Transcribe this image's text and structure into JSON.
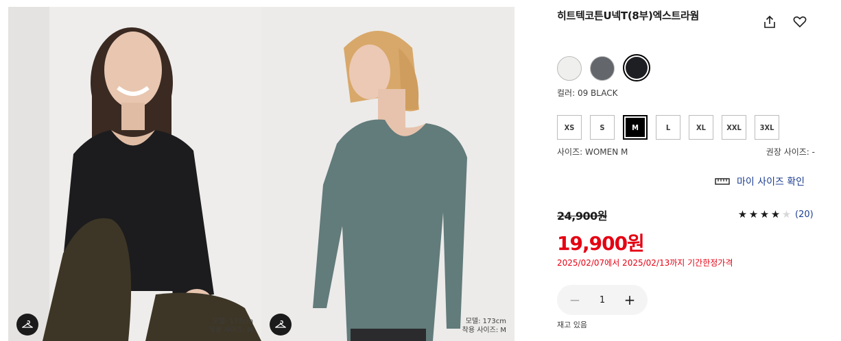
{
  "gallery": {
    "photos": [
      {
        "model_height": "모델: 173cm",
        "wear_size": "착용 사이즈: M",
        "icon": "hanger-icon"
      },
      {
        "model_height": "모델: 173cm",
        "wear_size": "착용 사이즈: M",
        "icon": "hanger-icon"
      }
    ]
  },
  "product": {
    "title": "히트텍코튼U넥T(8부)엑스트라웜",
    "share_icon": "share-icon",
    "favorite_icon": "heart-icon"
  },
  "colors": {
    "options": [
      {
        "hex": "#efefed"
      },
      {
        "hex": "#63666b"
      },
      {
        "hex": "#1e1f23",
        "selected": true
      }
    ],
    "label": "컬러: 09 BLACK"
  },
  "sizes": {
    "options": [
      "XS",
      "S",
      "M",
      "L",
      "XL",
      "XXL",
      "3XL"
    ],
    "selected": "M",
    "label": "사이즈: WOMEN M",
    "recommended": "권장 사이즈: -"
  },
  "my_size": {
    "label": "마이 사이즈 확인",
    "icon": "ruler-icon"
  },
  "pricing": {
    "original": "24,900원",
    "sale": "19,900원",
    "promo": "2025/02/07에서 2025/02/13까지 기간한정가격",
    "sale_color": "#e50012"
  },
  "rating": {
    "stars": 4,
    "max": 5,
    "count": "(20)"
  },
  "quantity": {
    "value": "1",
    "minus": "−",
    "plus": "+"
  },
  "stock": "재고 있음"
}
